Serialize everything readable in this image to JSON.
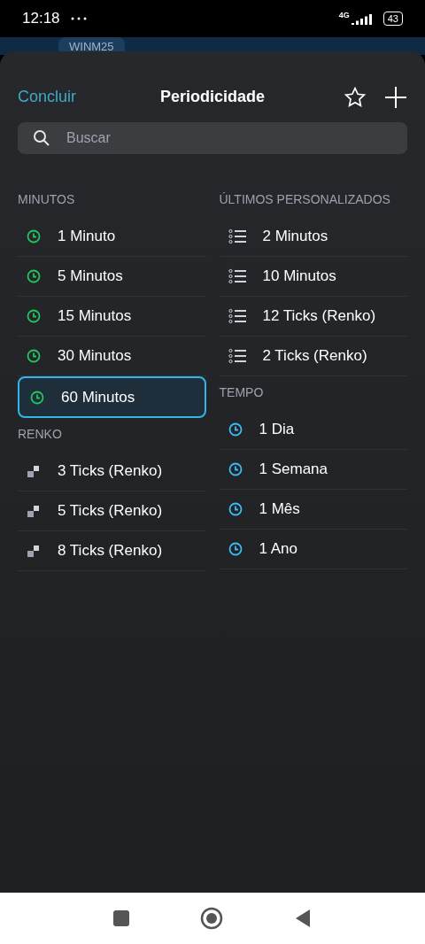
{
  "status_bar": {
    "time": "12:18",
    "network": "4G",
    "battery": "43"
  },
  "background_tab": {
    "label": "WINM25"
  },
  "header": {
    "done": "Concluir",
    "title": "Periodicidade"
  },
  "search": {
    "placeholder": "Buscar"
  },
  "columns": [
    {
      "sections": [
        {
          "title": "MINUTOS",
          "kind": "minutes",
          "items": [
            {
              "label": "1 Minuto",
              "selected": false
            },
            {
              "label": "5 Minutos",
              "selected": false
            },
            {
              "label": "15 Minutos",
              "selected": false
            },
            {
              "label": "30 Minutos",
              "selected": false
            },
            {
              "label": "60 Minutos",
              "selected": true
            }
          ]
        },
        {
          "title": "RENKO",
          "kind": "renko",
          "items": [
            {
              "label": "3 Ticks (Renko)",
              "selected": false
            },
            {
              "label": "5 Ticks (Renko)",
              "selected": false
            },
            {
              "label": "8 Ticks (Renko)",
              "selected": false
            }
          ]
        }
      ]
    },
    {
      "sections": [
        {
          "title": "ÚLTIMOS PERSONALIZADOS",
          "kind": "custom",
          "items": [
            {
              "label": "2 Minutos",
              "selected": false
            },
            {
              "label": "10 Minutos",
              "selected": false
            },
            {
              "label": "12 Ticks (Renko)",
              "selected": false
            },
            {
              "label": "2 Ticks (Renko)",
              "selected": false
            }
          ]
        },
        {
          "title": "TEMPO",
          "kind": "time",
          "items": [
            {
              "label": "1 Dia",
              "selected": false
            },
            {
              "label": "1 Semana",
              "selected": false
            },
            {
              "label": "1 Mês",
              "selected": false
            },
            {
              "label": "1 Ano",
              "selected": false
            }
          ]
        }
      ]
    }
  ]
}
